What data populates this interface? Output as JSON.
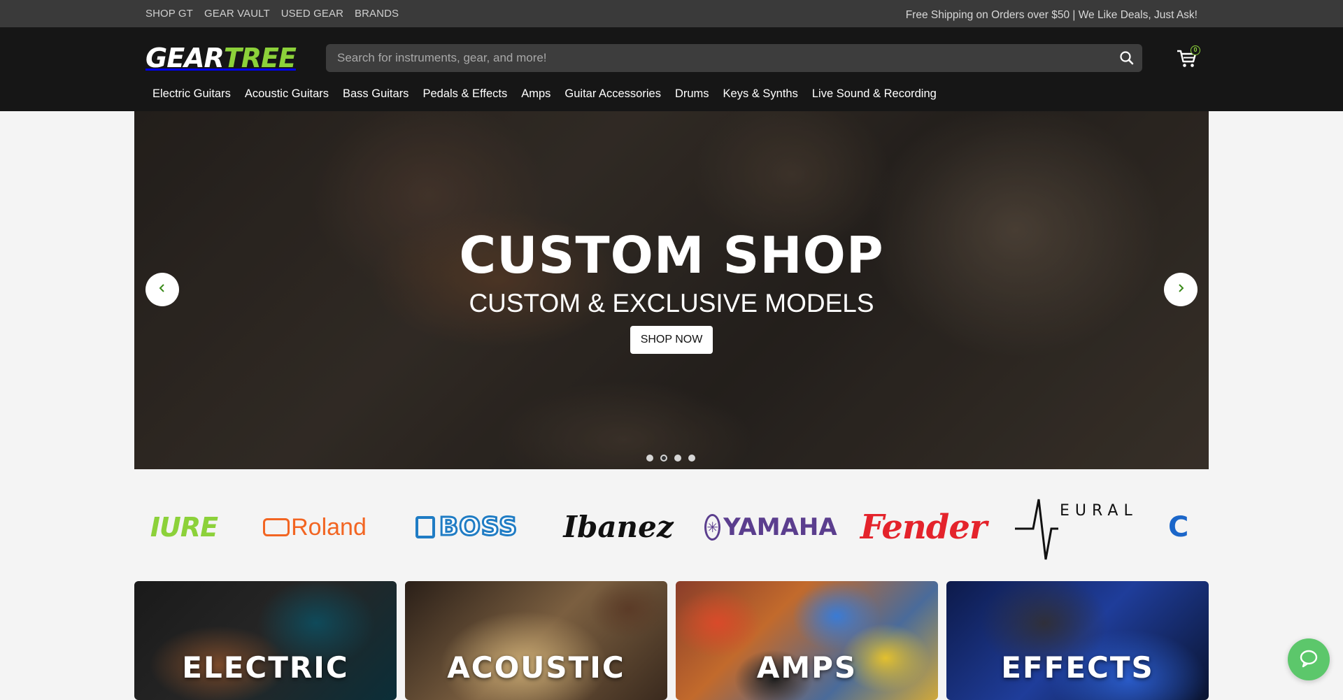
{
  "topbar": {
    "links": [
      "SHOP GT",
      "GEAR VAULT",
      "USED GEAR",
      "BRANDS"
    ],
    "promo": "Free Shipping on Orders over $50 | We Like Deals, Just Ask!"
  },
  "header": {
    "logo_part1": "GEAR",
    "logo_part2": "TREE",
    "search_placeholder": "Search for instruments, gear, and more!",
    "cart_count": "0",
    "brand_color": "#8cd13a",
    "categories": [
      "Electric Guitars",
      "Acoustic Guitars",
      "Bass Guitars",
      "Pedals & Effects",
      "Amps",
      "Guitar Accessories",
      "Drums",
      "Keys & Synths",
      "Live Sound & Recording"
    ]
  },
  "hero": {
    "title": "CUSTOM SHOP",
    "subtitle": "CUSTOM & EXCLUSIVE MODELS",
    "cta": "SHOP NOW",
    "slide_count": 4,
    "active_slide": 2
  },
  "brands": [
    {
      "name": "IURE",
      "color": "#8cd13a"
    },
    {
      "name": "Roland",
      "color": "#f26522"
    },
    {
      "name": "BOSS",
      "color": "#1f7cc4"
    },
    {
      "name": "Ibanez",
      "color": "#111111"
    },
    {
      "name": "YAMAHA",
      "color": "#5b3e8e"
    },
    {
      "name": "Fender",
      "color": "#e4232b"
    },
    {
      "name": "EURAL",
      "color": "#111111"
    },
    {
      "name": "C",
      "color": "#1b66c9"
    }
  ],
  "tiles": [
    {
      "label": "ELECTRIC"
    },
    {
      "label": "ACOUSTIC"
    },
    {
      "label": "AMPS"
    },
    {
      "label": "EFFECTS"
    }
  ],
  "chat": {
    "icon": "chat-bubble-icon",
    "color": "#5cc76b"
  }
}
